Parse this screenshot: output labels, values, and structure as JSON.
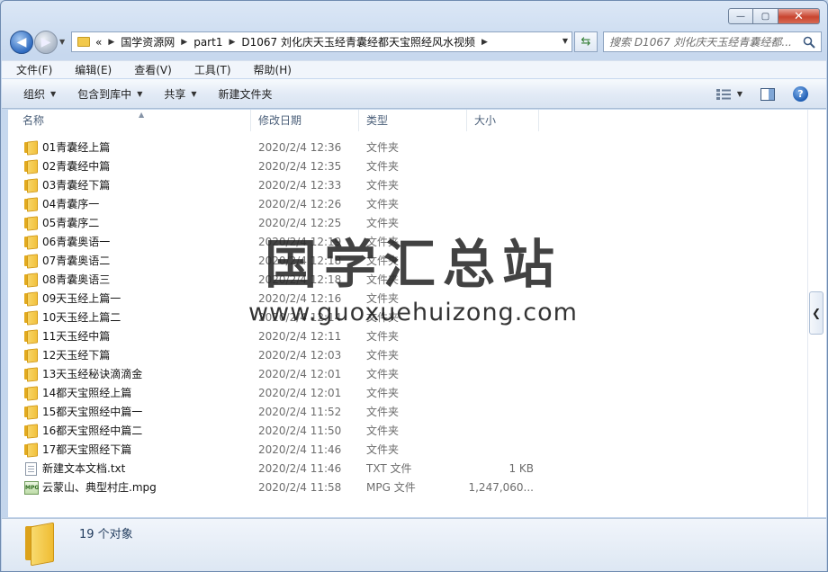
{
  "window": {
    "minimize": "—",
    "maximize": "▢",
    "close": "✕"
  },
  "address": {
    "overflow": "«",
    "crumbs": [
      "国学资源网",
      "part1",
      "D1067 刘化庆天玉经青囊经都天宝照经风水视频"
    ]
  },
  "search": {
    "placeholder": "搜索 D1067 刘化庆天玉经青囊经都..."
  },
  "menu": [
    "文件(F)",
    "编辑(E)",
    "查看(V)",
    "工具(T)",
    "帮助(H)"
  ],
  "toolbar": {
    "organize": "组织",
    "include_library": "包含到库中",
    "share": "共享",
    "new_folder": "新建文件夹",
    "help": "?"
  },
  "columns": {
    "name": "名称",
    "date": "修改日期",
    "type": "类型",
    "size": "大小"
  },
  "files": [
    {
      "name": "01青囊经上篇",
      "date": "2020/2/4 12:36",
      "type": "文件夹",
      "size": "",
      "icon": "folder-icon"
    },
    {
      "name": "02青囊经中篇",
      "date": "2020/2/4 12:35",
      "type": "文件夹",
      "size": "",
      "icon": "folder-icon"
    },
    {
      "name": "03青囊经下篇",
      "date": "2020/2/4 12:33",
      "type": "文件夹",
      "size": "",
      "icon": "folder-icon"
    },
    {
      "name": "04青囊序一",
      "date": "2020/2/4 12:26",
      "type": "文件夹",
      "size": "",
      "icon": "folder-icon"
    },
    {
      "name": "05青囊序二",
      "date": "2020/2/4 12:25",
      "type": "文件夹",
      "size": "",
      "icon": "folder-icon"
    },
    {
      "name": "06青囊奥语一",
      "date": "2020/2/4 12:19",
      "type": "文件夹",
      "size": "",
      "icon": "folder-icon"
    },
    {
      "name": "07青囊奥语二",
      "date": "2020/2/4 12:18",
      "type": "文件夹",
      "size": "",
      "icon": "folder-icon"
    },
    {
      "name": "08青囊奥语三",
      "date": "2020/2/4 12:18",
      "type": "文件夹",
      "size": "",
      "icon": "folder-icon"
    },
    {
      "name": "09天玉经上篇一",
      "date": "2020/2/4 12:16",
      "type": "文件夹",
      "size": "",
      "icon": "folder-icon"
    },
    {
      "name": "10天玉经上篇二",
      "date": "2020/2/4 12:14",
      "type": "文件夹",
      "size": "",
      "icon": "folder-icon"
    },
    {
      "name": "11天玉经中篇",
      "date": "2020/2/4 12:11",
      "type": "文件夹",
      "size": "",
      "icon": "folder-icon"
    },
    {
      "name": "12天玉经下篇",
      "date": "2020/2/4 12:03",
      "type": "文件夹",
      "size": "",
      "icon": "folder-icon"
    },
    {
      "name": "13天玉经秘诀滴滴金",
      "date": "2020/2/4 12:01",
      "type": "文件夹",
      "size": "",
      "icon": "folder-icon"
    },
    {
      "name": "14都天宝照经上篇",
      "date": "2020/2/4 12:01",
      "type": "文件夹",
      "size": "",
      "icon": "folder-icon"
    },
    {
      "name": "15都天宝照经中篇一",
      "date": "2020/2/4 11:52",
      "type": "文件夹",
      "size": "",
      "icon": "folder-icon"
    },
    {
      "name": "16都天宝照经中篇二",
      "date": "2020/2/4 11:50",
      "type": "文件夹",
      "size": "",
      "icon": "folder-icon"
    },
    {
      "name": "17都天宝照经下篇",
      "date": "2020/2/4 11:46",
      "type": "文件夹",
      "size": "",
      "icon": "folder-icon"
    },
    {
      "name": "新建文本文档.txt",
      "date": "2020/2/4 11:46",
      "type": "TXT 文件",
      "size": "1 KB",
      "icon": "txt-file-icon"
    },
    {
      "name": "云蒙山、典型村庄.mpg",
      "date": "2020/2/4 11:58",
      "type": "MPG 文件",
      "size": "1,247,060...",
      "icon": "mpg-file-icon",
      "badge": "MPG"
    }
  ],
  "watermark": {
    "title": "国学汇总站",
    "url": "www.guoxuehuizong.com"
  },
  "status": {
    "count": "19 个对象"
  },
  "colors": {
    "accent": "#2f6bc0",
    "folder": "#f2c13c"
  }
}
